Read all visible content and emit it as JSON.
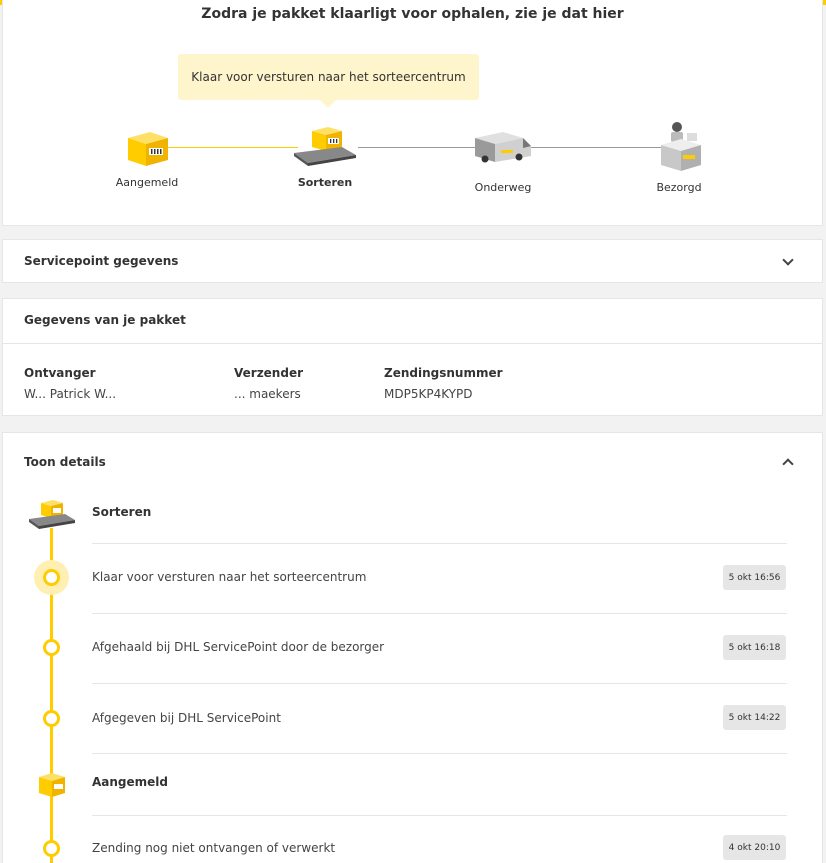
{
  "progress": {
    "title": "Zodra je pakket klaarligt voor ophalen, zie je dat hier",
    "bubble": "Klaar voor versturen naar het sorteercentrum",
    "steps": [
      {
        "label": "Aangemeld",
        "icon": "parcel-icon"
      },
      {
        "label": "Sorteren",
        "icon": "conveyor-parcel-icon"
      },
      {
        "label": "Onderweg",
        "icon": "delivery-van-icon"
      },
      {
        "label": "Bezorgd",
        "icon": "delivered-person-icon"
      }
    ],
    "active_step": "Sorteren"
  },
  "servicepoint": {
    "title": "Servicepoint gegevens"
  },
  "package": {
    "title": "Gegevens van je pakket",
    "recipient_label": "Ontvanger",
    "recipient_value": "W... Patrick W...",
    "sender_label": "Verzender",
    "sender_value": "... maekers",
    "tracking_label": "Zendingsnummer",
    "tracking_value": "MDP5KP4KYPD"
  },
  "details": {
    "title": "Toon details",
    "groups": [
      {
        "name": "Sorteren",
        "events": [
          {
            "text": "Klaar voor versturen naar het sorteercentrum",
            "time": "5 okt 16:56"
          },
          {
            "text": "Afgehaald bij DHL ServicePoint door de bezorger",
            "time": "5 okt 16:18"
          },
          {
            "text": "Afgegeven bij DHL ServicePoint",
            "time": "5 okt 14:22"
          }
        ]
      },
      {
        "name": "Aangemeld",
        "events": [
          {
            "text": "Zending nog niet ontvangen of verwerkt",
            "time": "4 okt 20:10"
          }
        ]
      }
    ]
  },
  "colors": {
    "accent": "#ffcc00",
    "bubble": "#fff5cc",
    "badge": "#e6e6e6"
  }
}
